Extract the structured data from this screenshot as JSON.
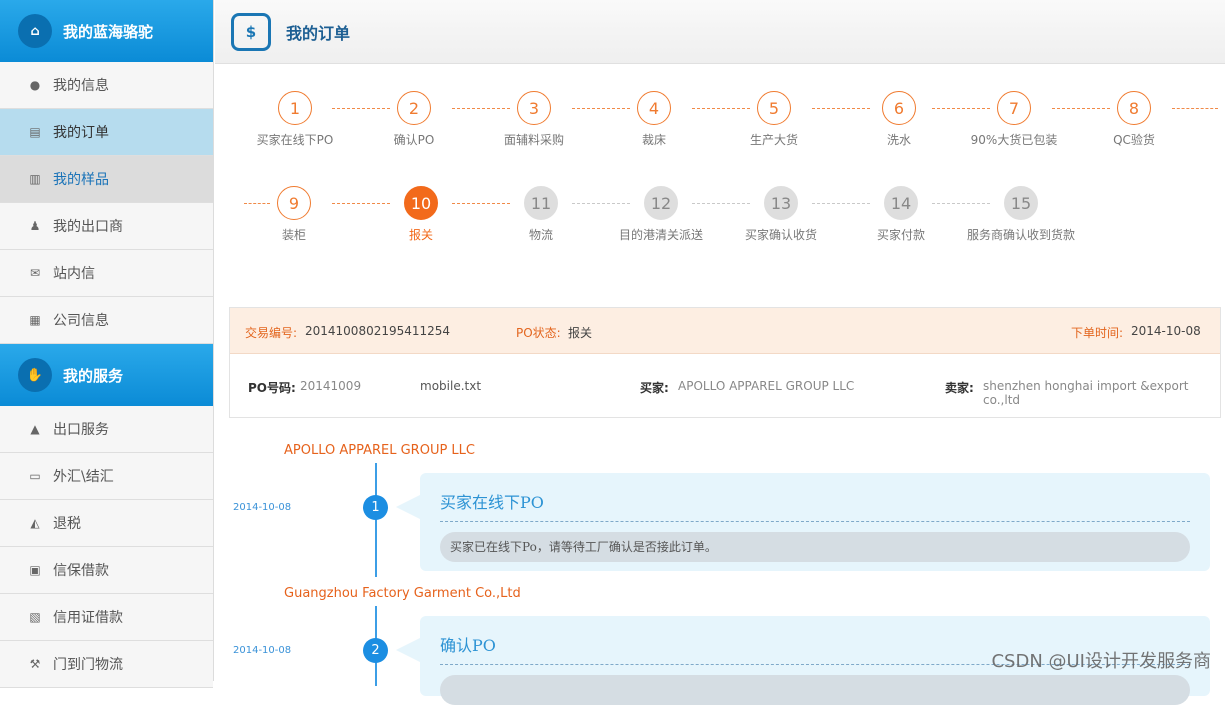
{
  "sidebar": {
    "section1": {
      "title": "我的蓝海骆驼",
      "icon": "home-icon"
    },
    "items1": [
      {
        "label": "我的信息",
        "icon": "user-icon"
      },
      {
        "label": "我的订单",
        "icon": "order-list-icon"
      },
      {
        "label": "我的样品",
        "icon": "sample-icon"
      },
      {
        "label": "我的出口商",
        "icon": "exporter-icon"
      },
      {
        "label": "站内信",
        "icon": "mail-icon"
      },
      {
        "label": "公司信息",
        "icon": "table-icon"
      }
    ],
    "section2": {
      "title": "我的服务",
      "icon": "service-hands-icon"
    },
    "items2": [
      {
        "label": "出口服务",
        "icon": "export-icon"
      },
      {
        "label": "外汇\\结汇",
        "icon": "currency-icon"
      },
      {
        "label": "退税",
        "icon": "tax-icon"
      },
      {
        "label": "信保借款",
        "icon": "credit-card-icon"
      },
      {
        "label": "信用证借款",
        "icon": "letter-credit-icon"
      },
      {
        "label": "门到门物流",
        "icon": "logistics-icon"
      }
    ]
  },
  "header": {
    "title": "我的订单",
    "icon": "order-dollar-icon"
  },
  "steps": [
    {
      "num": "1",
      "label": "买家在线下PO",
      "state": "done"
    },
    {
      "num": "2",
      "label": "确认PO",
      "state": "done"
    },
    {
      "num": "3",
      "label": "面辅料采购",
      "state": "done"
    },
    {
      "num": "4",
      "label": "裁床",
      "state": "done"
    },
    {
      "num": "5",
      "label": "生产大货",
      "state": "done"
    },
    {
      "num": "6",
      "label": "洗水",
      "state": "done"
    },
    {
      "num": "7",
      "label": "90%大货已包装",
      "state": "done"
    },
    {
      "num": "8",
      "label": "QC验货",
      "state": "done"
    },
    {
      "num": "9",
      "label": "装柜",
      "state": "done"
    },
    {
      "num": "10",
      "label": "报关",
      "state": "current"
    },
    {
      "num": "11",
      "label": "物流",
      "state": "todo"
    },
    {
      "num": "12",
      "label": "目的港清关派送",
      "state": "todo"
    },
    {
      "num": "13",
      "label": "买家确认收货",
      "state": "todo"
    },
    {
      "num": "14",
      "label": "买家付款",
      "state": "todo"
    },
    {
      "num": "15",
      "label": "服务商确认收到货款",
      "state": "todo"
    }
  ],
  "order": {
    "trade_no_label": "交易编号:",
    "trade_no": "2014100802195411254",
    "po_status_label": "PO状态:",
    "po_status": "报关",
    "order_time_label": "下单时间:",
    "order_time": "2014-10-08",
    "po_code_label": "PO号码:",
    "po_code": "20141009",
    "file": "mobile.txt",
    "buyer_label": "买家:",
    "buyer": "APOLLO APPAREL GROUP LLC",
    "seller_label": "卖家:",
    "seller": "shenzhen honghai import &export co.,ltd"
  },
  "timeline": [
    {
      "company": "APOLLO APPAREL GROUP LLC",
      "date": "2014-10-08",
      "num": "1",
      "title": "买家在线下PO",
      "message": "买家已在线下Po，请等待工厂确认是否接此订单。"
    },
    {
      "company": "Guangzhou Factory Garment Co.,Ltd",
      "date": "2014-10-08",
      "num": "2",
      "title": "确认PO",
      "message": ""
    }
  ],
  "watermark": "CSDN @UI设计开发服务商"
}
